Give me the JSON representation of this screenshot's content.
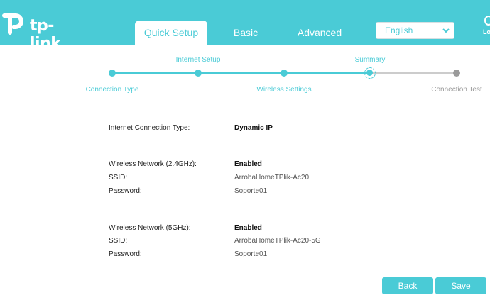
{
  "brand": {
    "logo_text": "tp-link",
    "accent_color": "#4acbd6"
  },
  "header": {
    "tabs": [
      {
        "label": "Quick Setup",
        "active": true
      },
      {
        "label": "Basic",
        "active": false
      },
      {
        "label": "Advanced",
        "active": false
      }
    ],
    "language": {
      "selected": "English"
    },
    "logout_label": "Lo"
  },
  "steps": [
    {
      "label": "Connection Type",
      "status": "done"
    },
    {
      "label": "Internet Setup",
      "status": "done"
    },
    {
      "label": "Wireless Settings",
      "status": "done"
    },
    {
      "label": "Summary",
      "status": "current"
    },
    {
      "label": "Connection Test",
      "status": "pending"
    }
  ],
  "summary": {
    "internet": {
      "label": "Internet Connection Type:",
      "value": "Dynamic IP"
    },
    "wireless_24": {
      "network_label": "Wireless Network (2.4GHz):",
      "network_value": "Enabled",
      "ssid_label": "SSID:",
      "ssid_value": "ArrobaHomeTPlik-Ac20",
      "password_label": "Password:",
      "password_value": "Soporte01"
    },
    "wireless_5": {
      "network_label": "Wireless Network (5GHz):",
      "network_value": "Enabled",
      "ssid_label": "SSID:",
      "ssid_value": "ArrobaHomeTPlik-Ac20-5G",
      "password_label": "Password:",
      "password_value": "Soporte01"
    }
  },
  "buttons": {
    "back": "Back",
    "save": "Save"
  }
}
